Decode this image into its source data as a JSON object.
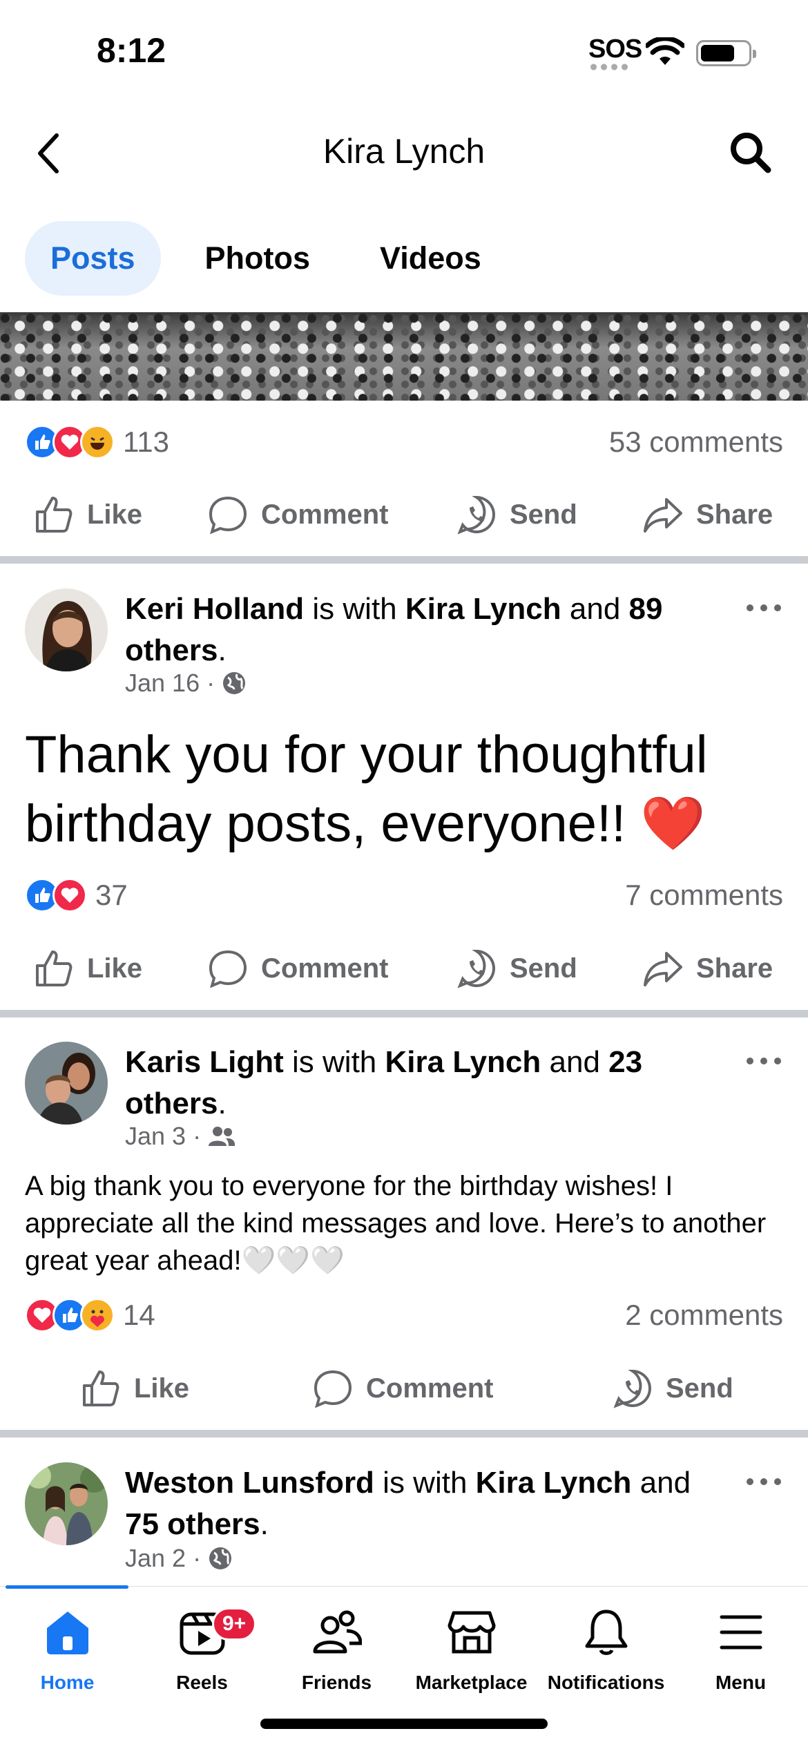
{
  "status_bar": {
    "time": "8:12",
    "sos": "SOS"
  },
  "header": {
    "title": "Kira Lynch"
  },
  "tabs": [
    {
      "label": "Posts"
    },
    {
      "label": "Photos"
    },
    {
      "label": "Videos"
    }
  ],
  "actions": {
    "like": "Like",
    "comment": "Comment",
    "send": "Send",
    "share": "Share"
  },
  "post0": {
    "reaction_count": "113",
    "comments": "53 comments"
  },
  "post1": {
    "author": "Keri Holland",
    "with_text": "is with",
    "tagged": "Kira Lynch",
    "and_text": "and",
    "others": "89 others",
    "date": "Jan 16",
    "privacy_icon": "globe-icon",
    "text": "Thank you for your thoughtful birthday posts, everyone!! ❤️",
    "reaction_count": "37",
    "comments": "7 comments"
  },
  "post2": {
    "author": "Karis Light",
    "with_text": "is with",
    "tagged": "Kira Lynch",
    "and_text": "and",
    "others": "23 others",
    "date": "Jan 3",
    "privacy_icon": "friends-icon",
    "text": "A big thank you to everyone for the birthday wishes! I appreciate all the kind messages and love.  Here’s to another great year ahead!🤍🤍🤍",
    "reaction_count": "14",
    "comments": "2 comments"
  },
  "post3": {
    "author": "Weston Lunsford",
    "with_text": "is with",
    "tagged": "Kira Lynch",
    "and_text": "and",
    "others": "75 others",
    "date": "Jan 2",
    "privacy_icon": "globe-icon"
  },
  "bottom_nav": {
    "home": "Home",
    "reels": "Reels",
    "reels_badge": "9+",
    "friends": "Friends",
    "marketplace": "Marketplace",
    "notifications": "Notifications",
    "menu": "Menu"
  },
  "colors": {
    "accent": "#1877f2",
    "active_tab_bg": "#e7f0fd",
    "muted": "#65676b",
    "badge": "#e41e3f"
  }
}
